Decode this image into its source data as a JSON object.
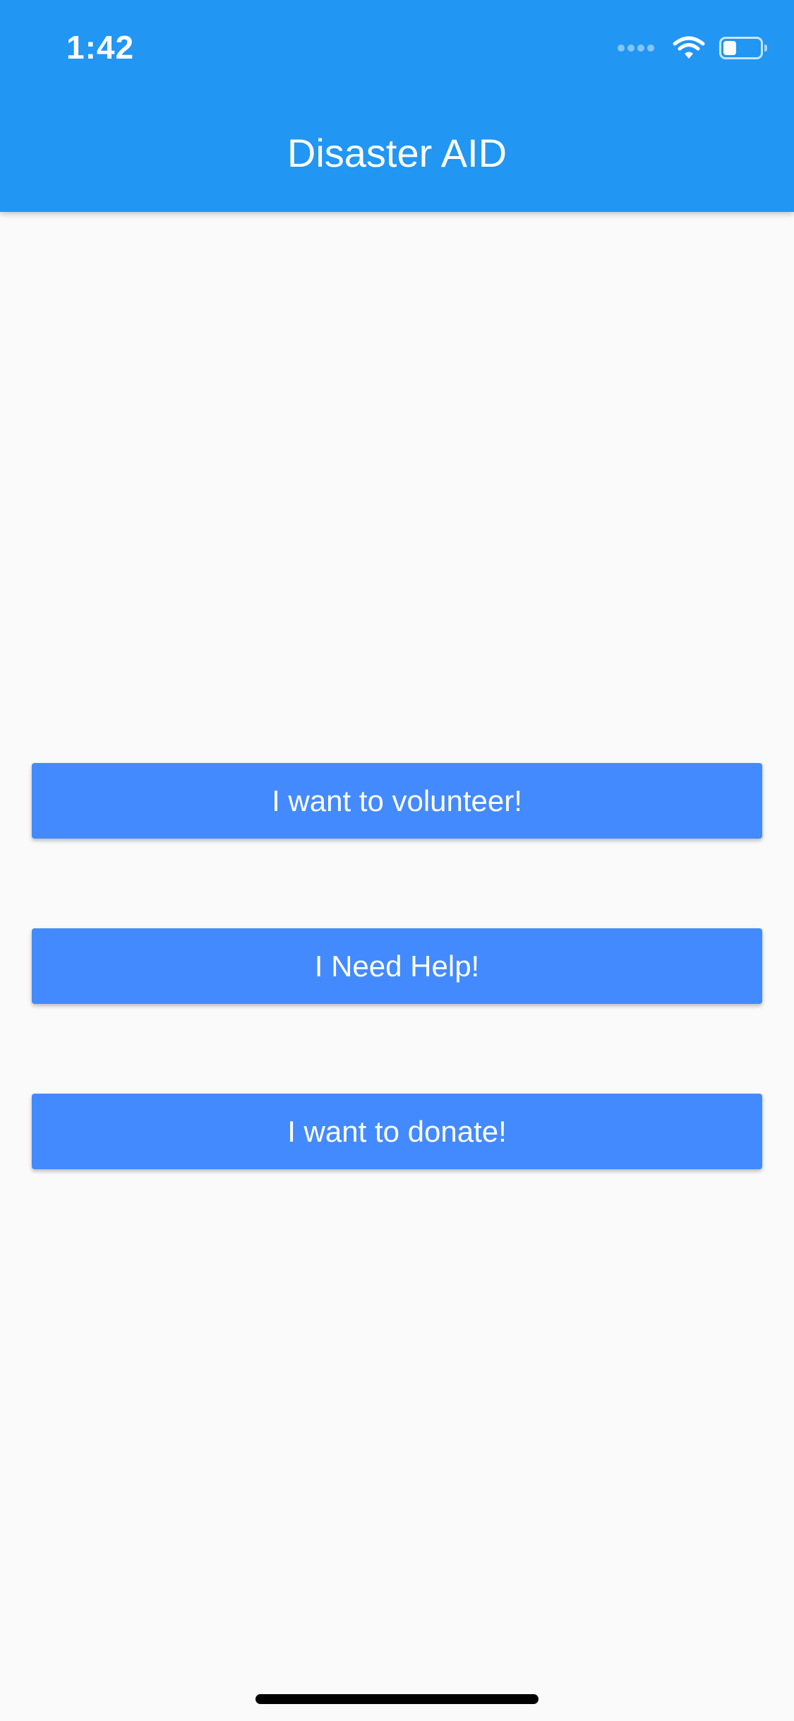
{
  "status_bar": {
    "time": "1:42",
    "battery_level": 0.35,
    "icons": [
      "signal-icon",
      "wifi-icon",
      "battery-icon"
    ]
  },
  "app_bar": {
    "title": "Disaster AID",
    "color": "#2196f3"
  },
  "actions": {
    "volunteer_label": "I want to volunteer!",
    "help_label": "I Need Help!",
    "donate_label": "I want to donate!",
    "button_color": "#448aff"
  },
  "colors": {
    "background": "#fafafa",
    "text_on_primary": "#ffffff"
  }
}
